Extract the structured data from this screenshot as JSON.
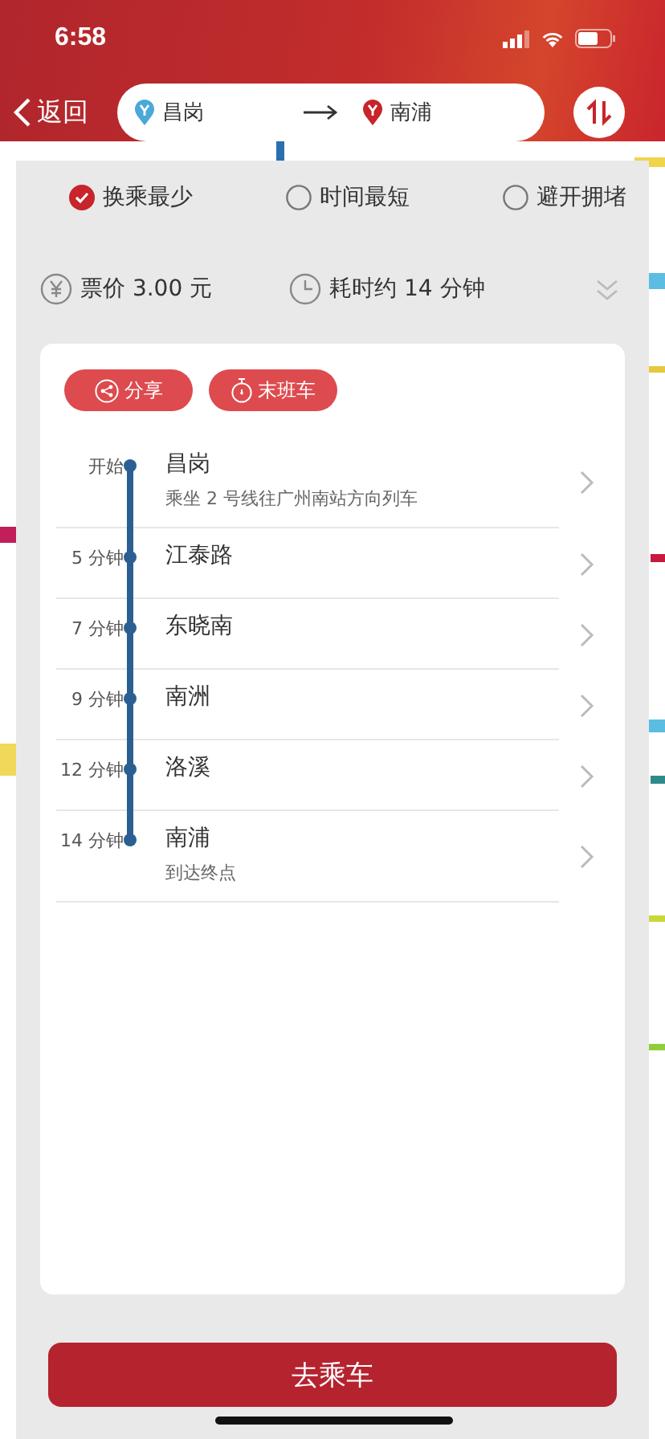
{
  "status_bar": {
    "time": "6:58"
  },
  "nav": {
    "back": "返回",
    "from": "昌岗",
    "to": "南浦"
  },
  "route_options": [
    {
      "label": "换乘最少",
      "selected": true
    },
    {
      "label": "时间最短",
      "selected": false
    },
    {
      "label": "避开拥堵",
      "selected": false
    }
  ],
  "summary": {
    "fare": "票价 3.00 元",
    "duration": "耗时约 14 分钟"
  },
  "actions": [
    {
      "kind": "share",
      "label": "分享"
    },
    {
      "kind": "last_train",
      "label": "末班车"
    }
  ],
  "stops": [
    {
      "time": "开始",
      "name": "昌岗",
      "note": "乘坐 2 号线往广州南站方向列车"
    },
    {
      "time": "5 分钟",
      "name": "江泰路"
    },
    {
      "time": "7 分钟",
      "name": "东晓南"
    },
    {
      "time": "9 分钟",
      "name": "南洲"
    },
    {
      "time": "12 分钟",
      "name": "洛溪"
    },
    {
      "time": "14 分钟",
      "name": "南浦",
      "note": "到达终点"
    }
  ],
  "go_button": "去乘车"
}
